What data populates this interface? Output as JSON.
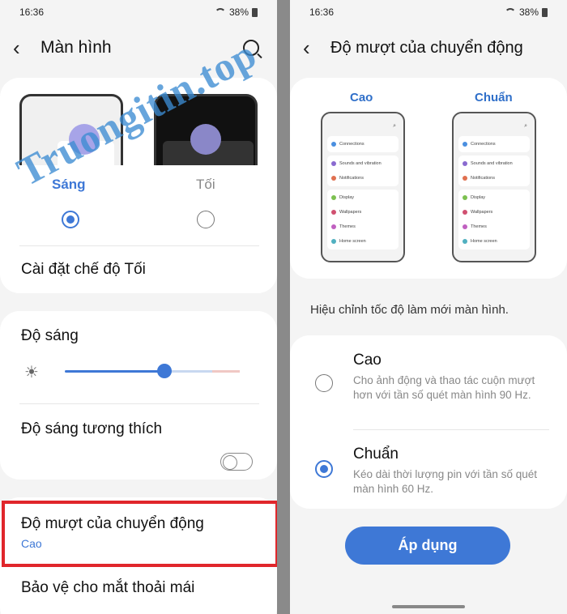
{
  "status": {
    "time": "16:36",
    "battery": "38%"
  },
  "left": {
    "title": "Màn hình",
    "themes": {
      "light_label": "Sáng",
      "dark_label": "Tối",
      "selected": "light"
    },
    "dark_mode_settings": "Cài đặt chế độ Tối",
    "brightness": {
      "label": "Độ sáng",
      "value": 0.6
    },
    "adaptive_brightness": {
      "label": "Độ sáng tương thích",
      "enabled": false
    },
    "motion_smoothness": {
      "label": "Độ mượt của chuyển động",
      "value": "Cao"
    },
    "eye_comfort": "Bảo vệ cho mắt thoải mái"
  },
  "right": {
    "title": "Độ mượt của chuyển động",
    "preview_high_label": "Cao",
    "preview_standard_label": "Chuẩn",
    "preview_items": [
      "Connections",
      "Sounds and vibration",
      "Notifications",
      "Display",
      "Wallpapers",
      "Themes",
      "Home screen"
    ],
    "hint": "Hiệu chỉnh tốc độ làm mới màn hình.",
    "options": [
      {
        "title": "Cao",
        "desc": "Cho ảnh động và thao tác cuộn mượt hơn với tần số quét màn hình 90 Hz.",
        "selected": false
      },
      {
        "title": "Chuẩn",
        "desc": "Kéo dài thời lượng pin với tần số quét màn hình 60 Hz.",
        "selected": true
      }
    ],
    "apply_button": "Áp dụng"
  },
  "watermark": "Truongitin.top",
  "colors": {
    "accent": "#3e78d6",
    "highlight": "#e0262b"
  }
}
